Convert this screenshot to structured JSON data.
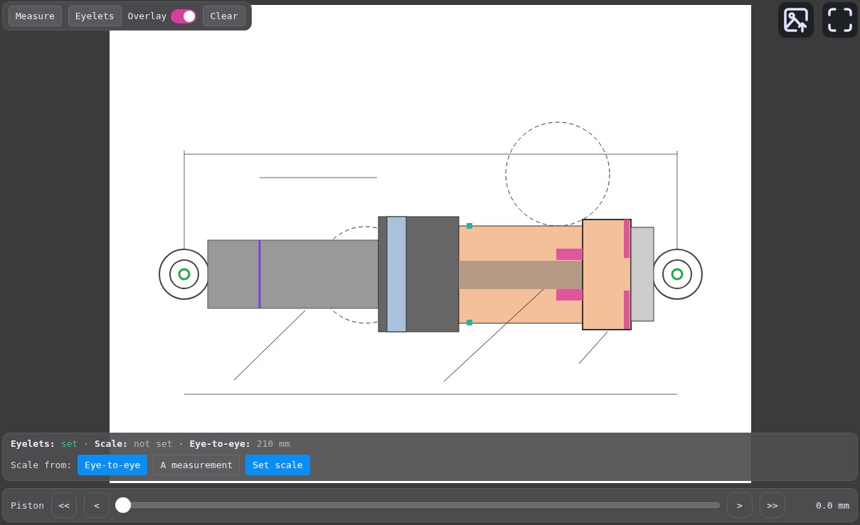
{
  "toolbar": {
    "buttons": [
      {
        "label": "Measure"
      },
      {
        "label": "Eyelets"
      }
    ],
    "overlay": {
      "label": "Overlay",
      "on": true
    },
    "clear": {
      "label": "Clear"
    }
  },
  "status": {
    "items": [
      {
        "label": "Eyelets:",
        "value": "set",
        "kind": "ok"
      },
      {
        "separator": "·",
        "label": "Scale:",
        "value": "not set",
        "kind": "muted"
      },
      {
        "separator": "·",
        "label": "Eye-to-eye:",
        "value": "210 mm",
        "kind": "muted"
      }
    ]
  },
  "scale_from": {
    "label": "Scale from:",
    "options": [
      {
        "label": "Eye-to-eye",
        "selected": true
      },
      {
        "label": "A measurement",
        "selected": false
      }
    ],
    "action": "Set scale"
  },
  "piston": {
    "label": "Piston",
    "back_buttons": [
      "<<",
      "<"
    ],
    "slider": {
      "level": 0
    },
    "forward_buttons": [
      ">",
      ">>"
    ],
    "reading": "0.0 mm"
  }
}
